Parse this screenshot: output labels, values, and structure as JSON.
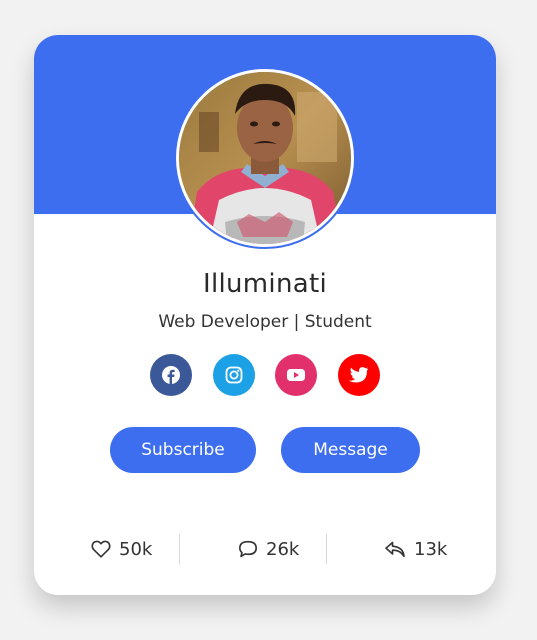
{
  "profile": {
    "name": "Illuminati",
    "role": "Web Developer | Student",
    "avatar_alt": "profile-photo"
  },
  "social": [
    {
      "name": "facebook",
      "icon": "facebook-icon",
      "color": "#3b5998"
    },
    {
      "name": "instagram",
      "icon": "instagram-icon",
      "color": "#1da1e6"
    },
    {
      "name": "youtube",
      "icon": "youtube-icon",
      "color": "#e1306c"
    },
    {
      "name": "twitter",
      "icon": "twitter-icon",
      "color": "#ff0000"
    }
  ],
  "buttons": {
    "subscribe": "Subscribe",
    "message": "Message"
  },
  "stats": {
    "likes": "50k",
    "comments": "26k",
    "shares": "13k"
  },
  "colors": {
    "accent": "#3e6ef0",
    "background": "#f2f2f2",
    "card": "#ffffff"
  }
}
